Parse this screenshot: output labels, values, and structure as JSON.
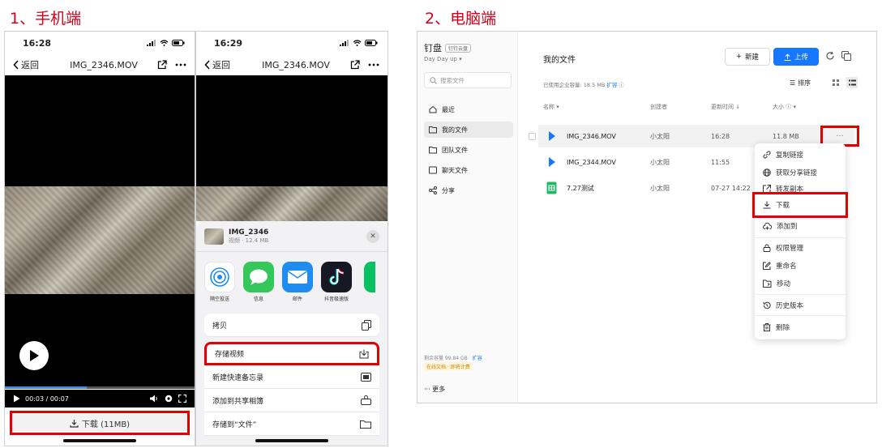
{
  "sections": {
    "mobile_title": "1、手机端",
    "pc_title": "2、电脑端"
  },
  "phone1": {
    "time": "16:28",
    "back": "返回",
    "title": "IMG_2346.MOV",
    "playback": "00:03 / 00:07",
    "progress_fraction": 0.43,
    "download_label": "下载 (11MB)"
  },
  "phone2": {
    "time": "16:29",
    "back": "返回",
    "title": "IMG_2346.MOV",
    "sheet_name": "IMG_2346",
    "sheet_meta": "视频 · 12.4 MB",
    "apps": [
      {
        "label": "隔空投送",
        "icon": "airdrop-icon",
        "color": "#ffffff"
      },
      {
        "label": "信息",
        "icon": "messages-icon",
        "color": "#34c759"
      },
      {
        "label": "邮件",
        "icon": "mail-icon",
        "color": "#1e8cf0"
      },
      {
        "label": "抖音极速版",
        "icon": "douyin-icon",
        "color": "#161823"
      }
    ],
    "actions": {
      "copy": "拷贝",
      "save_video": "存储视频",
      "quick_note": "新建快速备忘录",
      "shared_album": "添加到共享相簿",
      "save_files": "存储到“文件”"
    }
  },
  "pc": {
    "brand": "钉盘",
    "brand_tag": "钉钉云盘",
    "workspace": "Day Day up",
    "search_placeholder": "搜索文件",
    "nav": {
      "recent": "最近",
      "my_files": "我的文件",
      "team_files": "团队文件",
      "chat_files": "聊天文件",
      "share": "分享"
    },
    "quota": "剩余容量 99.84 GB",
    "quota_expand": "扩容",
    "quota_tag": "在线文档 · 即将计费",
    "more": "更多",
    "breadcrumb": "我的文件",
    "new_button": "新建",
    "upload_button": "上传",
    "usage": "已使用企业容量: 18.5 MB",
    "usage_expand": "扩容",
    "sort_label": "排序",
    "columns": {
      "name": "名称",
      "owner": "创建者",
      "updated": "更新时间",
      "size": "大小"
    },
    "files": [
      {
        "name": "IMG_2346.MOV",
        "owner": "小太阳",
        "time": "16:28",
        "size": "11.8 MB"
      },
      {
        "name": "IMG_2344.MOV",
        "owner": "小太阳",
        "time": "11:55",
        "size": ""
      },
      {
        "name": "7.27测试",
        "owner": "小太阳",
        "time": "07-27 14:22",
        "size": ""
      }
    ],
    "menu": {
      "copy_link": "复制链接",
      "share_link": "获取分享链接",
      "forward_copy": "转发副本",
      "download": "下载",
      "add_to": "添加到",
      "permissions": "权限管理",
      "rename": "重命名",
      "move": "移动",
      "history": "历史版本",
      "delete": "删除"
    }
  }
}
